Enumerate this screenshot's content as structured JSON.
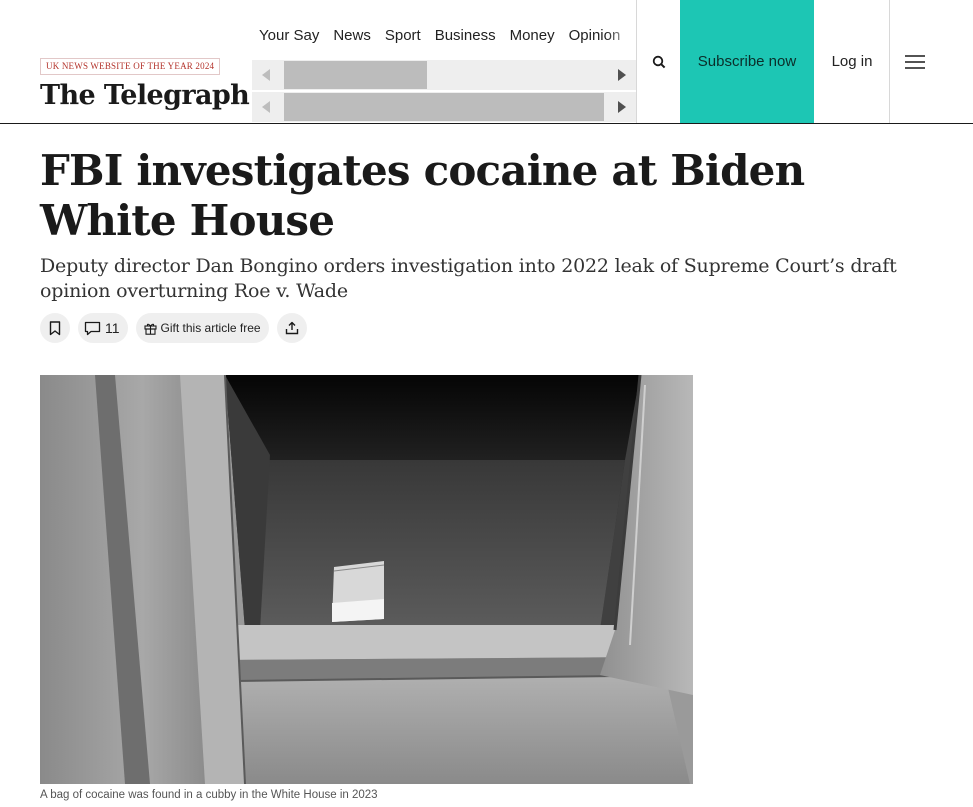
{
  "header": {
    "award": "UK NEWS WEBSITE OF THE YEAR 2024",
    "logo": "The Telegraph",
    "nav": [
      "Your Say",
      "News",
      "Sport",
      "Business",
      "Money",
      "Opinion"
    ],
    "subscribe_label": "Subscribe now",
    "login_label": "Log in",
    "icons": {
      "search": "search-icon",
      "menu": "hamburger-menu-icon"
    },
    "accent_color": "#1dc6b4"
  },
  "article": {
    "headline": "FBI investigates cocaine at Biden White House",
    "standfirst": "Deputy director Dan Bongino orders investigation into 2022 leak of Supreme Court’s draft opinion overturning Roe v. Wade",
    "actions": {
      "comment_count": "11",
      "gift_label": "Gift this article free",
      "icons": [
        "bookmark-icon",
        "comment-icon",
        "gift-icon",
        "share-icon"
      ]
    },
    "caption": "A bag of cocaine was found in a cubby in the White House in 2023"
  }
}
